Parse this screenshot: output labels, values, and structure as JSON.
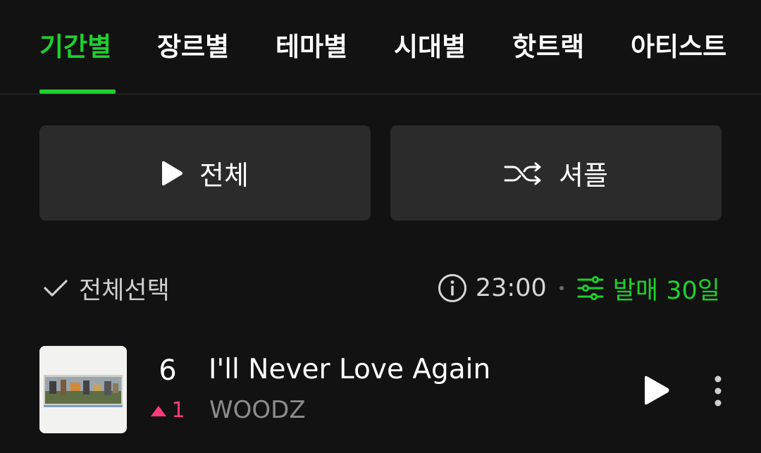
{
  "tabs": [
    {
      "label": "기간별",
      "active": true
    },
    {
      "label": "장르별",
      "active": false
    },
    {
      "label": "테마별",
      "active": false
    },
    {
      "label": "시대별",
      "active": false
    },
    {
      "label": "핫트랙",
      "active": false
    },
    {
      "label": "아티스트",
      "active": false
    }
  ],
  "actions": {
    "play_all_label": "전체",
    "shuffle_label": "셔플"
  },
  "options": {
    "select_all_label": "전체선택",
    "time": "23:00",
    "filter_label": "발매 30일"
  },
  "tracks": [
    {
      "rank": "6",
      "rank_change": "1",
      "rank_direction": "up",
      "title": "I'll Never Love Again",
      "artist": "WOODZ"
    }
  ],
  "colors": {
    "accent": "#1ed02f",
    "background": "#121212",
    "button_bg": "#2b2b2b",
    "rank_up": "#ff3a7a",
    "muted_text": "#8c8c8c"
  },
  "icons": {
    "play": "play-icon",
    "shuffle": "shuffle-icon",
    "check": "check-icon",
    "info": "info-icon",
    "filter": "filter-icon",
    "more": "more-vertical-icon",
    "rank_up": "triangle-up-icon"
  }
}
